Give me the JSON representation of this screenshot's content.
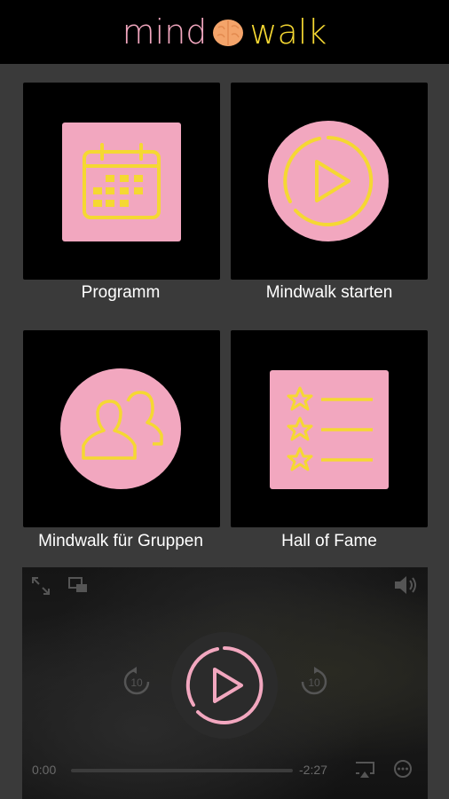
{
  "header": {
    "logo_left": "mind",
    "logo_right": "walk",
    "logo_icon": "brain-icon"
  },
  "tiles": [
    {
      "label": "Programm",
      "icon": "calendar-icon"
    },
    {
      "label": "Mindwalk starten",
      "icon": "play-circle-icon"
    },
    {
      "label": "Mindwalk für Gruppen",
      "icon": "group-icon"
    },
    {
      "label": "Hall of Fame",
      "icon": "star-list-icon"
    }
  ],
  "video": {
    "current_time": "0:00",
    "remaining_time": "-2:27",
    "skip_back": "10",
    "skip_forward": "10",
    "progress": 0
  },
  "colors": {
    "pink": "#f2a7bf",
    "yellow": "#f5d832",
    "tile_bg": "#000000",
    "page_bg": "#3a3a3a"
  }
}
